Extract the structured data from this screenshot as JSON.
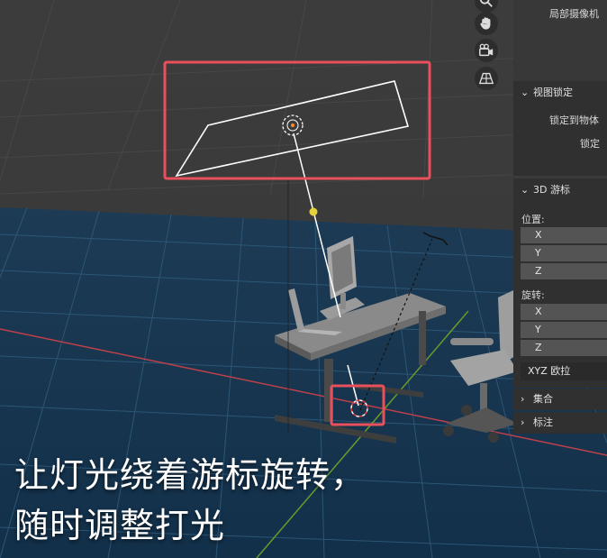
{
  "panel": {
    "top_label": "局部摄像机",
    "view_lock": {
      "title": "视图锁定",
      "lock_to_object": "锁定到物体",
      "lock": "锁定"
    },
    "cursor3d": {
      "title": "3D 游标",
      "location_label": "位置:",
      "location_fields": [
        "X",
        "Y",
        "Z"
      ],
      "rotation_label": "旋转:",
      "rotation_fields": [
        "X",
        "Y",
        "Z"
      ],
      "rotation_mode": "XYZ 欧拉"
    },
    "collections": "集合",
    "annotations": "标注"
  },
  "toolbar": {
    "icons": [
      "zoom-icon",
      "hand-pan-icon",
      "camera-view-icon",
      "grid-perspective-icon"
    ]
  },
  "caption": {
    "line1": "让灯光绕着游标旋转，",
    "line2": "随时调整打光"
  },
  "colors": {
    "highlight_box": "#e8505b",
    "grid_line": "#3d6a8a",
    "x_axis": "#c0404a",
    "y_axis": "#6a9a2a",
    "light_dot": "#e6d23a"
  }
}
